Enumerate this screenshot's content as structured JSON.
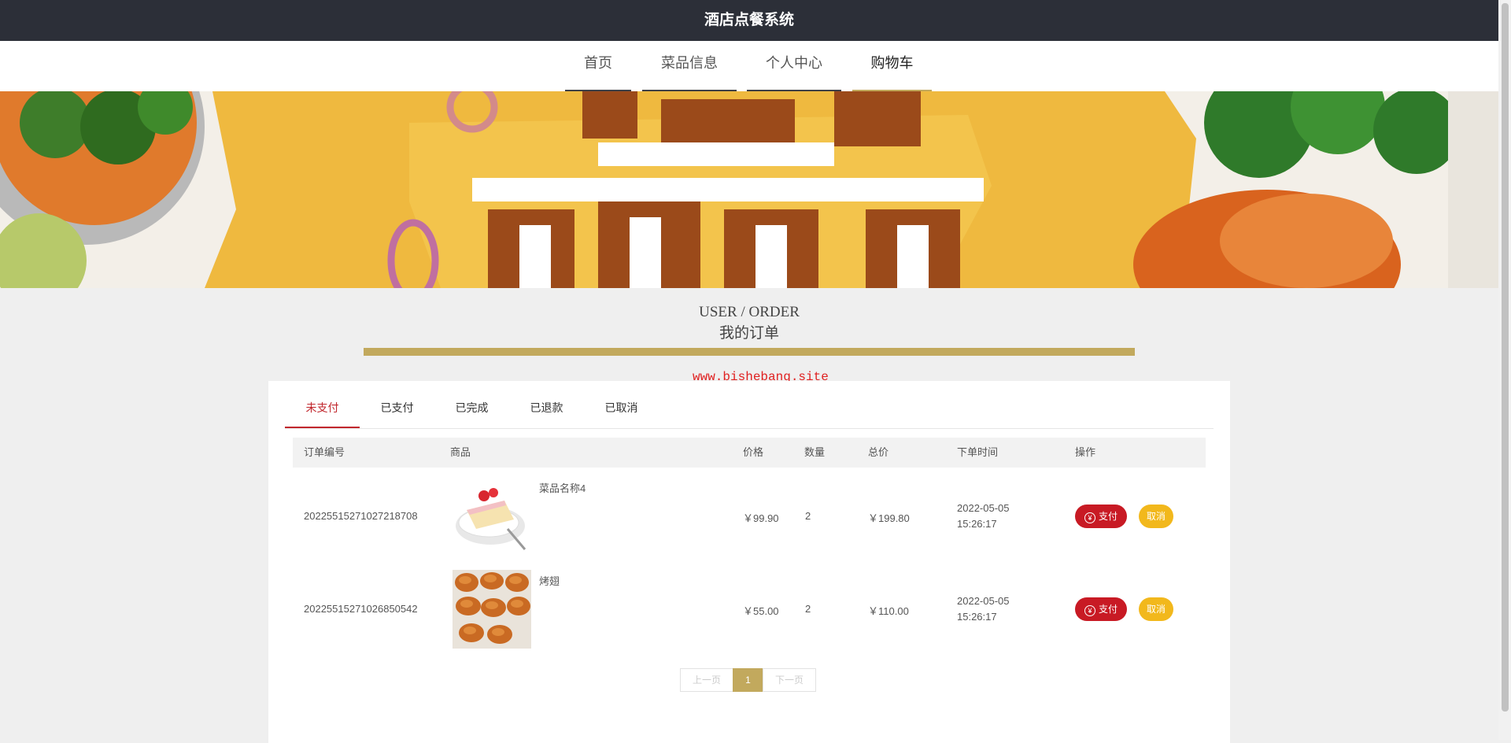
{
  "header": {
    "title": "酒店点餐系统"
  },
  "nav": {
    "items": [
      {
        "label": "首页"
      },
      {
        "label": "菜品信息"
      },
      {
        "label": "个人中心"
      },
      {
        "label": "购物车"
      }
    ],
    "active_index": 3
  },
  "section": {
    "en": "USER / ORDER",
    "cn": "我的订单"
  },
  "watermark": "www.bishebang.site",
  "tabs": [
    {
      "label": "未支付"
    },
    {
      "label": "已支付"
    },
    {
      "label": "已完成"
    },
    {
      "label": "已退款"
    },
    {
      "label": "已取消"
    }
  ],
  "active_tab": 0,
  "table": {
    "headers": [
      "订单编号",
      "商品",
      "价格",
      "数量",
      "总价",
      "下单时间",
      "操作"
    ],
    "rows": [
      {
        "order_no": "20225515271027218708",
        "name": "菜品名称4",
        "image": "cake-image",
        "price": "￥99.90",
        "qty": "2",
        "total": "￥199.80",
        "date": "2022-05-05",
        "time": "15:26:17",
        "pay": "支付",
        "cancel": "取消"
      },
      {
        "order_no": "20225515271026850542",
        "name": "烤翅",
        "image": "chicken-wings-image",
        "price": "￥55.00",
        "qty": "2",
        "total": "￥110.00",
        "date": "2022-05-05",
        "time": "15:26:17",
        "pay": "支付",
        "cancel": "取消"
      }
    ]
  },
  "pager": {
    "prev": "上一页",
    "current": "1",
    "next": "下一页"
  },
  "colors": {
    "accent": "#c2a95d",
    "danger": "#c81a24",
    "warning": "#f2b81c",
    "header": "#2c2f38"
  }
}
